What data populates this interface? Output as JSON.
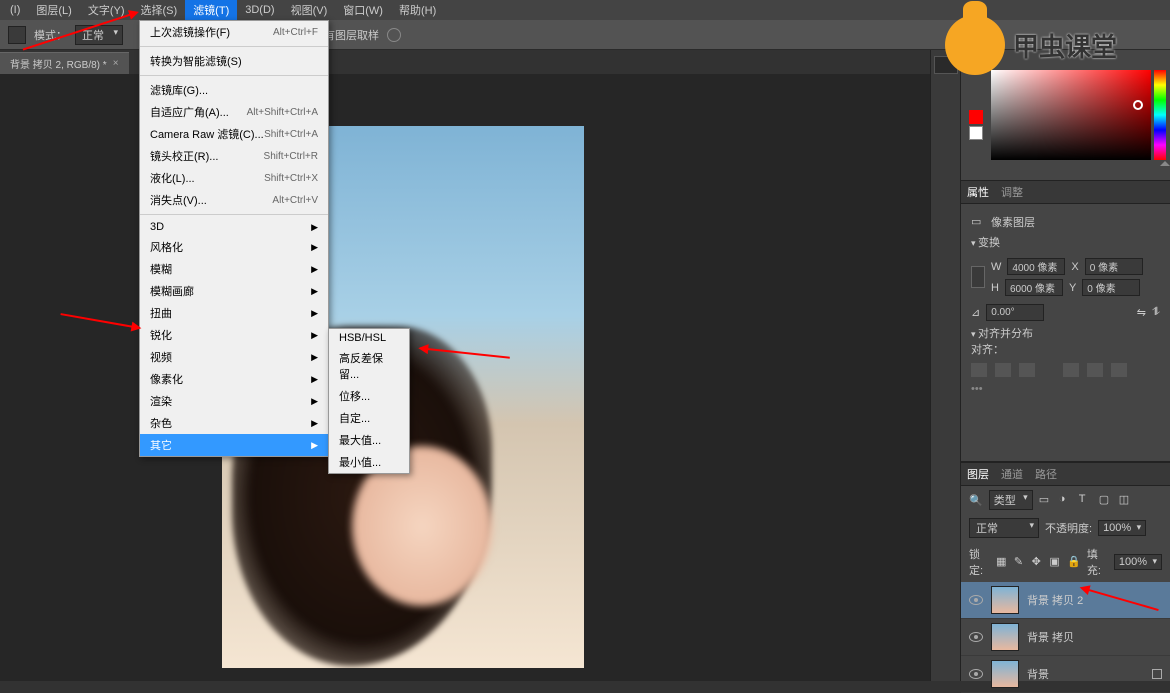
{
  "menubar": {
    "items": [
      {
        "label": "(I)"
      },
      {
        "label": "图层(L)"
      },
      {
        "label": "文字(Y)"
      },
      {
        "label": "选择(S)"
      },
      {
        "label": "滤镜(T)",
        "active": true
      },
      {
        "label": "3D(D)"
      },
      {
        "label": "视图(V)"
      },
      {
        "label": "窗口(W)"
      },
      {
        "label": "帮助(H)"
      }
    ]
  },
  "optionbar": {
    "mode_label": "模式：",
    "mode_value": "正常",
    "sample_all_label": "对所有图层取样"
  },
  "doctab": {
    "title": "背景 拷贝 2, RGB/8) *"
  },
  "filter_menu": {
    "items": [
      {
        "label": "上次滤镜操作(F)",
        "shortcut": "Alt+Ctrl+F"
      },
      {
        "label": "转换为智能滤镜(S)"
      },
      {
        "label": "滤镜库(G)..."
      },
      {
        "label": "自适应广角(A)...",
        "shortcut": "Alt+Shift+Ctrl+A"
      },
      {
        "label": "Camera Raw 滤镜(C)...",
        "shortcut": "Shift+Ctrl+A"
      },
      {
        "label": "镜头校正(R)...",
        "shortcut": "Shift+Ctrl+R"
      },
      {
        "label": "液化(L)...",
        "shortcut": "Shift+Ctrl+X"
      },
      {
        "label": "消失点(V)...",
        "shortcut": "Alt+Ctrl+V"
      },
      {
        "label": "3D",
        "sub": true
      },
      {
        "label": "风格化",
        "sub": true
      },
      {
        "label": "模糊",
        "sub": true
      },
      {
        "label": "模糊画廊",
        "sub": true
      },
      {
        "label": "扭曲",
        "sub": true
      },
      {
        "label": "锐化",
        "sub": true
      },
      {
        "label": "视频",
        "sub": true
      },
      {
        "label": "像素化",
        "sub": true
      },
      {
        "label": "渲染",
        "sub": true
      },
      {
        "label": "杂色",
        "sub": true
      },
      {
        "label": "其它",
        "sub": true,
        "highlight": true
      }
    ]
  },
  "submenu": {
    "items": [
      {
        "label": "HSB/HSL"
      },
      {
        "label": "高反差保留..."
      },
      {
        "label": "位移..."
      },
      {
        "label": "自定..."
      },
      {
        "label": "最大值..."
      },
      {
        "label": "最小值..."
      }
    ]
  },
  "properties": {
    "tab1": "属性",
    "tab2": "调整",
    "kind": "像素图层",
    "transform_label": "变换",
    "w_label": "W",
    "w_value": "4000 像素",
    "x_label": "X",
    "x_value": "0 像素",
    "h_label": "H",
    "h_value": "6000 像素",
    "y_label": "Y",
    "y_value": "0 像素",
    "angle_value": "0.00°",
    "align_label": "对齐并分布",
    "align_sublabel": "对齐："
  },
  "layers": {
    "tab1": "图层",
    "tab2": "通道",
    "tab3": "路径",
    "type_label": "类型",
    "blend_label": "正常",
    "opacity_label": "不透明度:",
    "opacity_value": "100%",
    "lock_label": "锁定:",
    "fill_label": "填充:",
    "fill_value": "100%",
    "rows": [
      {
        "name": "背景 拷贝 2",
        "active": true
      },
      {
        "name": "背景 拷贝"
      },
      {
        "name": "背景",
        "locked": true
      }
    ]
  },
  "logo_text": "甲虫课堂"
}
